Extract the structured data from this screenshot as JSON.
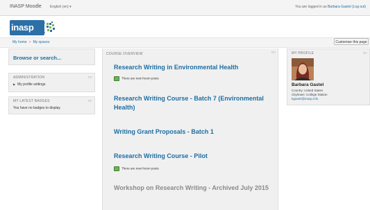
{
  "header": {
    "site_name": "INASP Moodle",
    "language": "English (en) ▾",
    "logged_in_prefix": "You are logged in as ",
    "user_name": "Barbara Gastel",
    "logout": " (Log out)"
  },
  "logo": {
    "text": "inasp"
  },
  "breadcrumb": {
    "items": [
      "My home",
      "My spaces"
    ],
    "separator": ">"
  },
  "customise_button": "Customise this page",
  "left": {
    "browse_link": "Browse or search...",
    "administration": {
      "title": "ADMINISTRATION",
      "items": [
        "My profile settings"
      ]
    },
    "badges": {
      "title": "MY LATEST BADGES",
      "empty_text": "You have no badges to display"
    }
  },
  "course_overview": {
    "title": "COURSE OVERVIEW",
    "courses": [
      {
        "name": "Research Writing in Environmental Health",
        "notice": "There are new forum posts"
      },
      {
        "name": "Research Writing Course - Batch 7 (Environmental Health)"
      },
      {
        "name": "Writing Grant Proposals - Batch 1"
      },
      {
        "name": "Research Writing Course - Pilot",
        "notice": "There are new forum posts"
      },
      {
        "name": "Workshop on Research Writing - Archived July 2015"
      }
    ]
  },
  "profile": {
    "title": "MY PROFILE",
    "name": "Barbara Gastel",
    "country": "Country: United States",
    "city": "City/town: College Station",
    "email": "bgastel@inasp.info"
  },
  "colors": {
    "link": "#1c6ea4",
    "archived": "#8a8a8a",
    "block_bg": "#f0f0f0",
    "logo_bg": "#2d6fa7"
  }
}
